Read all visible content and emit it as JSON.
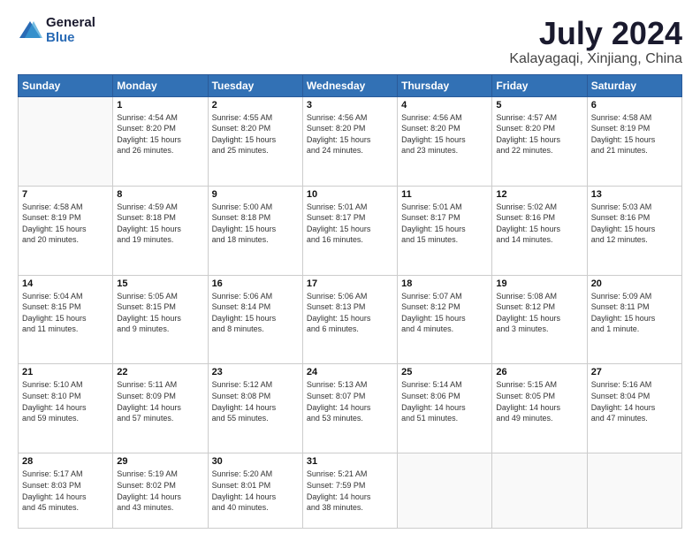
{
  "logo": {
    "general": "General",
    "blue": "Blue"
  },
  "title": {
    "month": "July 2024",
    "location": "Kalayagaqi, Xinjiang, China"
  },
  "header_days": [
    "Sunday",
    "Monday",
    "Tuesday",
    "Wednesday",
    "Thursday",
    "Friday",
    "Saturday"
  ],
  "weeks": [
    [
      {
        "date": "",
        "info": ""
      },
      {
        "date": "1",
        "info": "Sunrise: 4:54 AM\nSunset: 8:20 PM\nDaylight: 15 hours\nand 26 minutes."
      },
      {
        "date": "2",
        "info": "Sunrise: 4:55 AM\nSunset: 8:20 PM\nDaylight: 15 hours\nand 25 minutes."
      },
      {
        "date": "3",
        "info": "Sunrise: 4:56 AM\nSunset: 8:20 PM\nDaylight: 15 hours\nand 24 minutes."
      },
      {
        "date": "4",
        "info": "Sunrise: 4:56 AM\nSunset: 8:20 PM\nDaylight: 15 hours\nand 23 minutes."
      },
      {
        "date": "5",
        "info": "Sunrise: 4:57 AM\nSunset: 8:20 PM\nDaylight: 15 hours\nand 22 minutes."
      },
      {
        "date": "6",
        "info": "Sunrise: 4:58 AM\nSunset: 8:19 PM\nDaylight: 15 hours\nand 21 minutes."
      }
    ],
    [
      {
        "date": "7",
        "info": "Sunrise: 4:58 AM\nSunset: 8:19 PM\nDaylight: 15 hours\nand 20 minutes."
      },
      {
        "date": "8",
        "info": "Sunrise: 4:59 AM\nSunset: 8:18 PM\nDaylight: 15 hours\nand 19 minutes."
      },
      {
        "date": "9",
        "info": "Sunrise: 5:00 AM\nSunset: 8:18 PM\nDaylight: 15 hours\nand 18 minutes."
      },
      {
        "date": "10",
        "info": "Sunrise: 5:01 AM\nSunset: 8:17 PM\nDaylight: 15 hours\nand 16 minutes."
      },
      {
        "date": "11",
        "info": "Sunrise: 5:01 AM\nSunset: 8:17 PM\nDaylight: 15 hours\nand 15 minutes."
      },
      {
        "date": "12",
        "info": "Sunrise: 5:02 AM\nSunset: 8:16 PM\nDaylight: 15 hours\nand 14 minutes."
      },
      {
        "date": "13",
        "info": "Sunrise: 5:03 AM\nSunset: 8:16 PM\nDaylight: 15 hours\nand 12 minutes."
      }
    ],
    [
      {
        "date": "14",
        "info": "Sunrise: 5:04 AM\nSunset: 8:15 PM\nDaylight: 15 hours\nand 11 minutes."
      },
      {
        "date": "15",
        "info": "Sunrise: 5:05 AM\nSunset: 8:15 PM\nDaylight: 15 hours\nand 9 minutes."
      },
      {
        "date": "16",
        "info": "Sunrise: 5:06 AM\nSunset: 8:14 PM\nDaylight: 15 hours\nand 8 minutes."
      },
      {
        "date": "17",
        "info": "Sunrise: 5:06 AM\nSunset: 8:13 PM\nDaylight: 15 hours\nand 6 minutes."
      },
      {
        "date": "18",
        "info": "Sunrise: 5:07 AM\nSunset: 8:12 PM\nDaylight: 15 hours\nand 4 minutes."
      },
      {
        "date": "19",
        "info": "Sunrise: 5:08 AM\nSunset: 8:12 PM\nDaylight: 15 hours\nand 3 minutes."
      },
      {
        "date": "20",
        "info": "Sunrise: 5:09 AM\nSunset: 8:11 PM\nDaylight: 15 hours\nand 1 minute."
      }
    ],
    [
      {
        "date": "21",
        "info": "Sunrise: 5:10 AM\nSunset: 8:10 PM\nDaylight: 14 hours\nand 59 minutes."
      },
      {
        "date": "22",
        "info": "Sunrise: 5:11 AM\nSunset: 8:09 PM\nDaylight: 14 hours\nand 57 minutes."
      },
      {
        "date": "23",
        "info": "Sunrise: 5:12 AM\nSunset: 8:08 PM\nDaylight: 14 hours\nand 55 minutes."
      },
      {
        "date": "24",
        "info": "Sunrise: 5:13 AM\nSunset: 8:07 PM\nDaylight: 14 hours\nand 53 minutes."
      },
      {
        "date": "25",
        "info": "Sunrise: 5:14 AM\nSunset: 8:06 PM\nDaylight: 14 hours\nand 51 minutes."
      },
      {
        "date": "26",
        "info": "Sunrise: 5:15 AM\nSunset: 8:05 PM\nDaylight: 14 hours\nand 49 minutes."
      },
      {
        "date": "27",
        "info": "Sunrise: 5:16 AM\nSunset: 8:04 PM\nDaylight: 14 hours\nand 47 minutes."
      }
    ],
    [
      {
        "date": "28",
        "info": "Sunrise: 5:17 AM\nSunset: 8:03 PM\nDaylight: 14 hours\nand 45 minutes."
      },
      {
        "date": "29",
        "info": "Sunrise: 5:19 AM\nSunset: 8:02 PM\nDaylight: 14 hours\nand 43 minutes."
      },
      {
        "date": "30",
        "info": "Sunrise: 5:20 AM\nSunset: 8:01 PM\nDaylight: 14 hours\nand 40 minutes."
      },
      {
        "date": "31",
        "info": "Sunrise: 5:21 AM\nSunset: 7:59 PM\nDaylight: 14 hours\nand 38 minutes."
      },
      {
        "date": "",
        "info": ""
      },
      {
        "date": "",
        "info": ""
      },
      {
        "date": "",
        "info": ""
      }
    ]
  ]
}
